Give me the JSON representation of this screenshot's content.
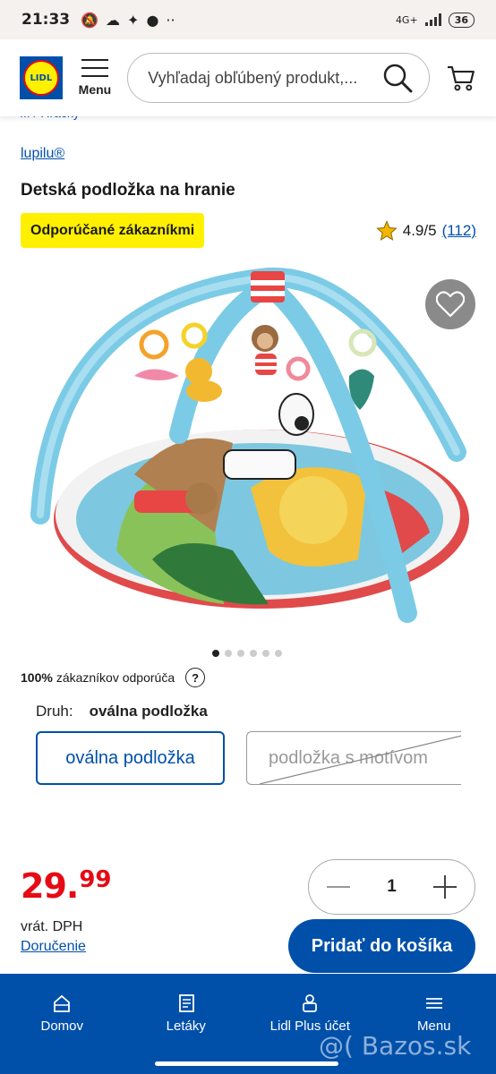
{
  "status": {
    "time": "21:33",
    "network": "4G+",
    "battery": "36"
  },
  "header": {
    "logo_text": "LIDL",
    "menu_label": "Menu",
    "search_placeholder": "Vyhľadaj obľúbený produkt,..."
  },
  "breadcrumb": {
    "text": "... / Hračky"
  },
  "product": {
    "brand": "lupilu®",
    "title": "Detská podložka na hranie",
    "badge": "Odporúčané zákazníkmi",
    "rating": "4.9/5",
    "review_count": "(112)",
    "image_count": 6,
    "recommend_percent": "100%",
    "recommend_text": "zákazníkov odporúča",
    "help_icon": "?",
    "variant_label": "Druh:",
    "variant_value": "oválna podložka",
    "options": [
      "oválna podložka",
      "podložka s motívom"
    ],
    "price_main": "29.",
    "price_cents": "99",
    "vat_text": "vrát. DPH",
    "delivery_text": "Doručenie",
    "quantity": "1",
    "add_to_cart": "Pridať do košíka"
  },
  "bottom_nav": {
    "items": [
      "Domov",
      "Letáky",
      "Lidl Plus účet",
      "Menu"
    ]
  },
  "watermark": "@( Bazos.sk",
  "colors": {
    "brand_blue": "#0050aa",
    "price_red": "#e60a14",
    "badge_yellow": "#fff000"
  }
}
